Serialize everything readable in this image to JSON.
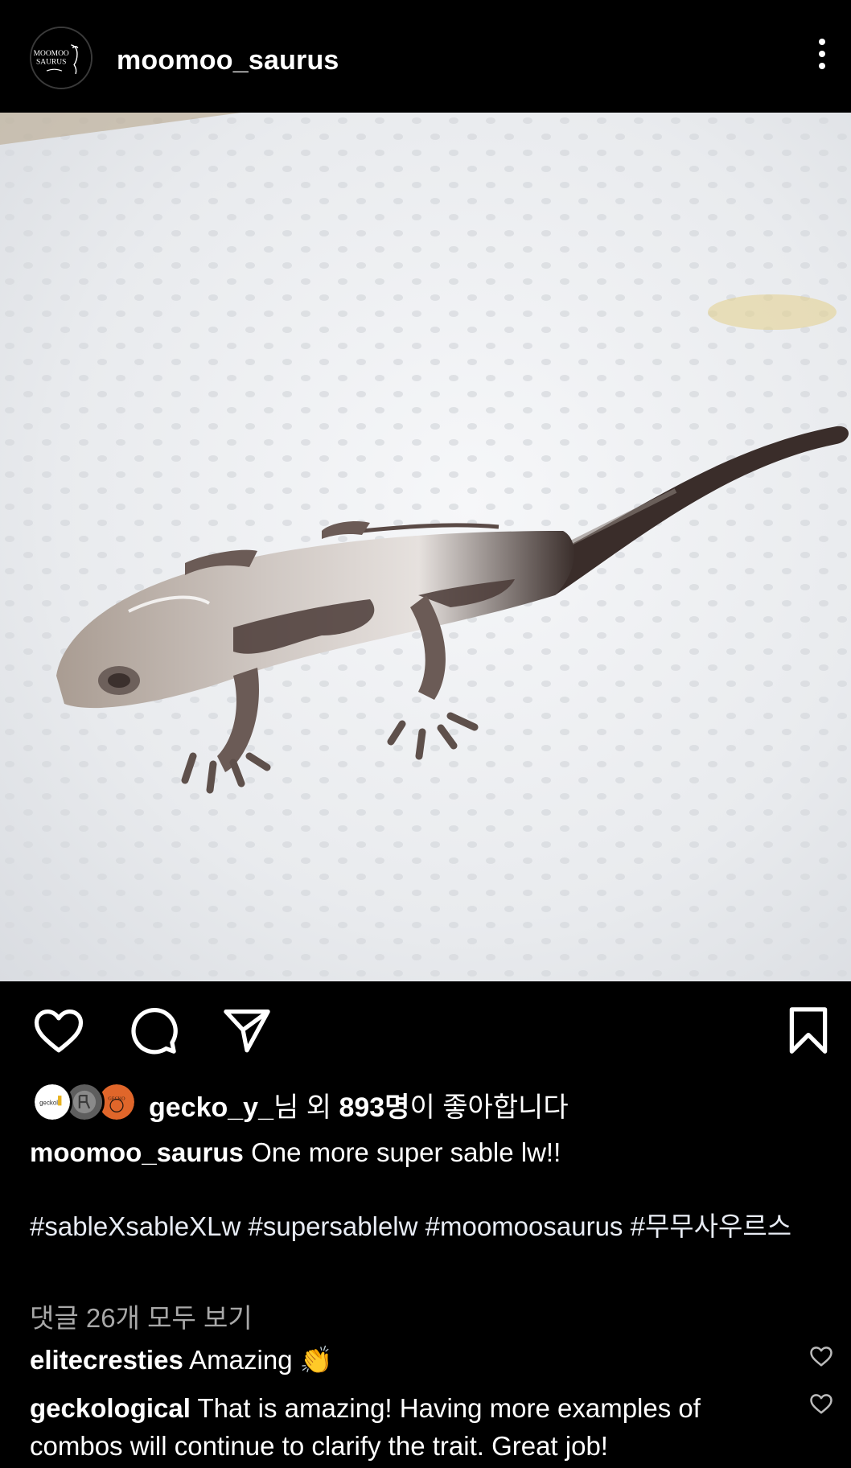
{
  "header": {
    "avatar_text_line1": "MOOMOO",
    "avatar_text_line2": "SAURUS",
    "username": "moomoo_saurus",
    "more_icon": "more-vertical-icon"
  },
  "post": {
    "image_subject": "gecko"
  },
  "actions": {
    "like_icon": "heart-icon",
    "comment_icon": "comment-icon",
    "share_icon": "send-icon",
    "save_icon": "bookmark-icon"
  },
  "likes": {
    "avatar_1_text": "geckol",
    "avatar_3_text": "GECKO",
    "liked_by_user": "gecko_y_",
    "liked_by_suffix_1": "님 외 ",
    "liked_count": "893명",
    "liked_by_suffix_2": "이 좋아합니다"
  },
  "caption": {
    "username": "moomoo_saurus",
    "text": "One more super sable lw!!",
    "hashtags": "#sableXsableXLw #supersablelw #moomoosaurus #무무사우르스"
  },
  "comments": {
    "view_all": "댓글 26개 모두 보기",
    "items": [
      {
        "username": "elitecresties",
        "text": "Amazing 👏"
      },
      {
        "username": "geckological",
        "text": "That is amazing! Having more examples of combos will continue to clarify the trait. Great job!"
      }
    ]
  },
  "colors": {
    "background": "#000000",
    "text": "#ffffff",
    "muted": "#a8a8a8"
  }
}
